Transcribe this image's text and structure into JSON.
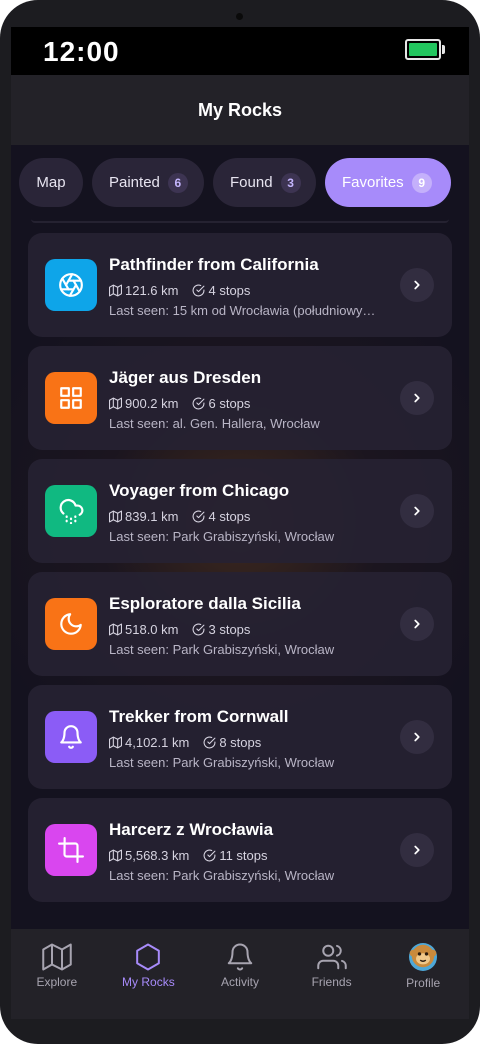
{
  "status_bar": {
    "time": "12:00"
  },
  "header": {
    "title": "My Rocks"
  },
  "tabs": [
    {
      "label": "Map",
      "count": null,
      "active": false
    },
    {
      "label": "Painted",
      "count": "6",
      "active": false
    },
    {
      "label": "Found",
      "count": "3",
      "active": false
    },
    {
      "label": "Favorites",
      "count": "9",
      "active": true
    }
  ],
  "rocks": [
    {
      "name": "Pathfinder from California",
      "distance": "121.6 km",
      "stops": "4 stops",
      "last_seen": "Last seen: 15 km od Wrocławia (południowy…",
      "icon": "aperture-icon",
      "color": "#0ea5e9"
    },
    {
      "name": "Jäger aus Dresden",
      "distance": "900.2 km",
      "stops": "6 stops",
      "last_seen": "Last seen: al. Gen. Hallera, Wrocław",
      "icon": "grid-icon",
      "color": "#f97316"
    },
    {
      "name": "Voyager from Chicago",
      "distance": "839.1 km",
      "stops": "4 stops",
      "last_seen": "Last seen: Park Grabiszyński, Wrocław",
      "icon": "cloud-drizzle-icon",
      "color": "#10b981"
    },
    {
      "name": "Esploratore dalla Sicilia",
      "distance": "518.0 km",
      "stops": "3 stops",
      "last_seen": "Last seen: Park Grabiszyński, Wrocław",
      "icon": "moon-icon",
      "color": "#f97316"
    },
    {
      "name": "Trekker from Cornwall",
      "distance": "4,102.1 km",
      "stops": "8 stops",
      "last_seen": "Last seen: Park Grabiszyński, Wrocław",
      "icon": "bell-icon",
      "color": "#8b5cf6"
    },
    {
      "name": "Harcerz z Wrocławia",
      "distance": "5,568.3 km",
      "stops": "11 stops",
      "last_seen": "Last seen: Park Grabiszyński, Wrocław",
      "icon": "crop-icon",
      "color": "#d946ef"
    }
  ],
  "bottom_nav": [
    {
      "label": "Explore",
      "icon": "map-icon",
      "active": false
    },
    {
      "label": "My Rocks",
      "icon": "hexagon-icon",
      "active": true
    },
    {
      "label": "Activity",
      "icon": "bell-icon",
      "active": false
    },
    {
      "label": "Friends",
      "icon": "users-icon",
      "active": false
    },
    {
      "label": "Profile",
      "icon": "avatar-icon",
      "active": false
    }
  ],
  "colors": {
    "accent": "#a78bfa",
    "background": "#14121f",
    "card": "#262232",
    "battery": "#22c55e"
  }
}
